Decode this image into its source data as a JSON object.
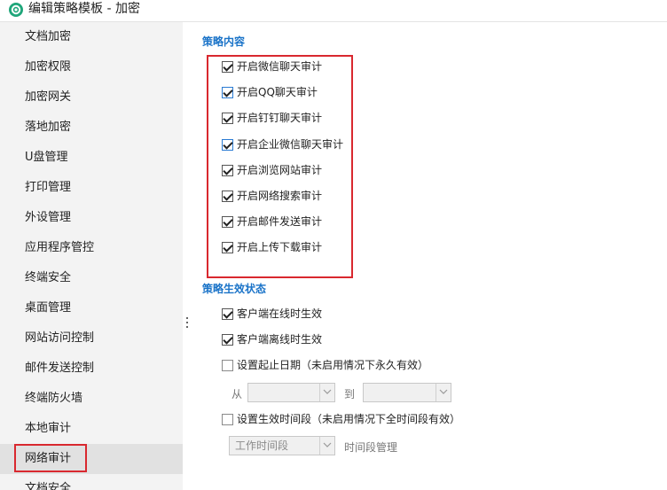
{
  "window": {
    "title": "编辑策略模板 - 加密"
  },
  "sidebar": {
    "items": [
      {
        "label": "文档加密"
      },
      {
        "label": "加密权限"
      },
      {
        "label": "加密网关"
      },
      {
        "label": "落地加密"
      },
      {
        "label": "U盘管理"
      },
      {
        "label": "打印管理"
      },
      {
        "label": "外设管理"
      },
      {
        "label": "应用程序管控"
      },
      {
        "label": "终端安全"
      },
      {
        "label": "桌面管理"
      },
      {
        "label": "网站访问控制"
      },
      {
        "label": "邮件发送控制"
      },
      {
        "label": "终端防火墙"
      },
      {
        "label": "本地审计"
      },
      {
        "label": "网络审计"
      },
      {
        "label": "文档安全"
      }
    ],
    "selected": "网络审计"
  },
  "content": {
    "section_title": "策略内容",
    "items": [
      {
        "label": "开启微信聊天审计",
        "checked": true
      },
      {
        "label": "开启QQ聊天审计",
        "checked": true
      },
      {
        "label": "开启钉钉聊天审计",
        "checked": true
      },
      {
        "label": "开启企业微信聊天审计",
        "checked": true
      },
      {
        "label": "开启浏览网站审计",
        "checked": true
      },
      {
        "label": "开启网络搜索审计",
        "checked": true
      },
      {
        "label": "开启邮件发送审计",
        "checked": true
      },
      {
        "label": "开启上传下载审计",
        "checked": true
      }
    ]
  },
  "effect": {
    "section_title": "策略生效状态",
    "online": {
      "label": "客户端在线时生效",
      "checked": true
    },
    "offline": {
      "label": "客户端离线时生效",
      "checked": true
    },
    "date_range": {
      "label": "设置起止日期（未启用情况下永久有效）",
      "checked": false
    },
    "from_label": "从",
    "to_label": "到",
    "from_value": "",
    "to_value": "",
    "time_period": {
      "label": "设置生效时间段（未启用情况下全时间段有效）",
      "checked": false
    },
    "period_select": "工作时间段",
    "period_manage": "时间段管理"
  },
  "colors": {
    "accent": "#1a73c8",
    "highlight_border": "#d9282f",
    "sidebar_bg": "#f3f3f3"
  }
}
